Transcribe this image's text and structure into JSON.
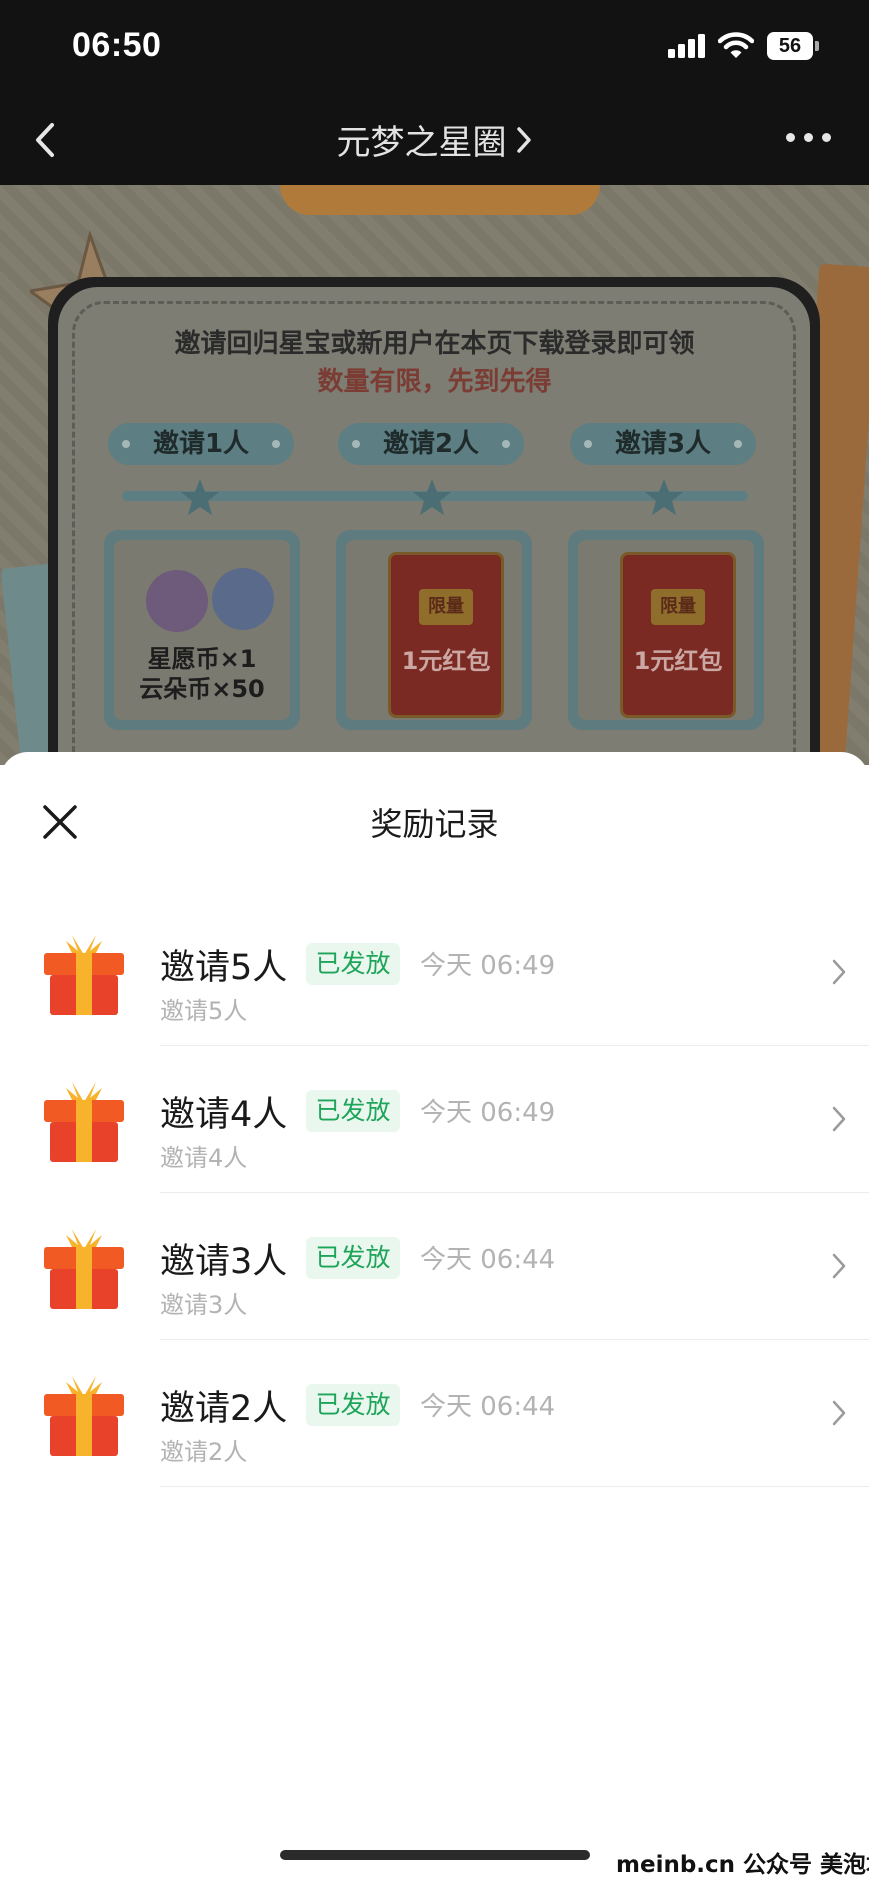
{
  "status_bar": {
    "time": "06:50",
    "battery": "56"
  },
  "nav": {
    "title": "元梦之星圈"
  },
  "event": {
    "line1": "邀请回归星宝或新用户在本页下载登录即可领",
    "line2": "数量有限，先到先得",
    "tiers": [
      "邀请1人",
      "邀请2人",
      "邀请3人"
    ],
    "reward1_line1": "星愿币×1",
    "reward1_line2": "云朵币×50",
    "envelope_badge": "限量",
    "envelope_label": "1元红包"
  },
  "sheet": {
    "title": "奖励记录",
    "records": [
      {
        "title": "邀请5人",
        "status": "已发放",
        "time": "今天 06:49",
        "subtitle": "邀请5人"
      },
      {
        "title": "邀请4人",
        "status": "已发放",
        "time": "今天 06:49",
        "subtitle": "邀请4人"
      },
      {
        "title": "邀请3人",
        "status": "已发放",
        "time": "今天 06:44",
        "subtitle": "邀请3人"
      },
      {
        "title": "邀请2人",
        "status": "已发放",
        "time": "今天 06:44",
        "subtitle": "邀请2人"
      }
    ]
  },
  "watermark": "meinb.cn 公众号 美泡君",
  "colors": {
    "status_green": "#1fa55a",
    "status_bg": "#eaf7ee",
    "dark_bar": "#121212",
    "gift_red": "#e8432a",
    "gift_ribbon": "#f7b32b"
  },
  "icons": [
    "back-icon",
    "chevron-right-icon",
    "more-icon",
    "close-icon",
    "gift-icon",
    "signal-icon",
    "wifi-icon",
    "battery-icon"
  ]
}
